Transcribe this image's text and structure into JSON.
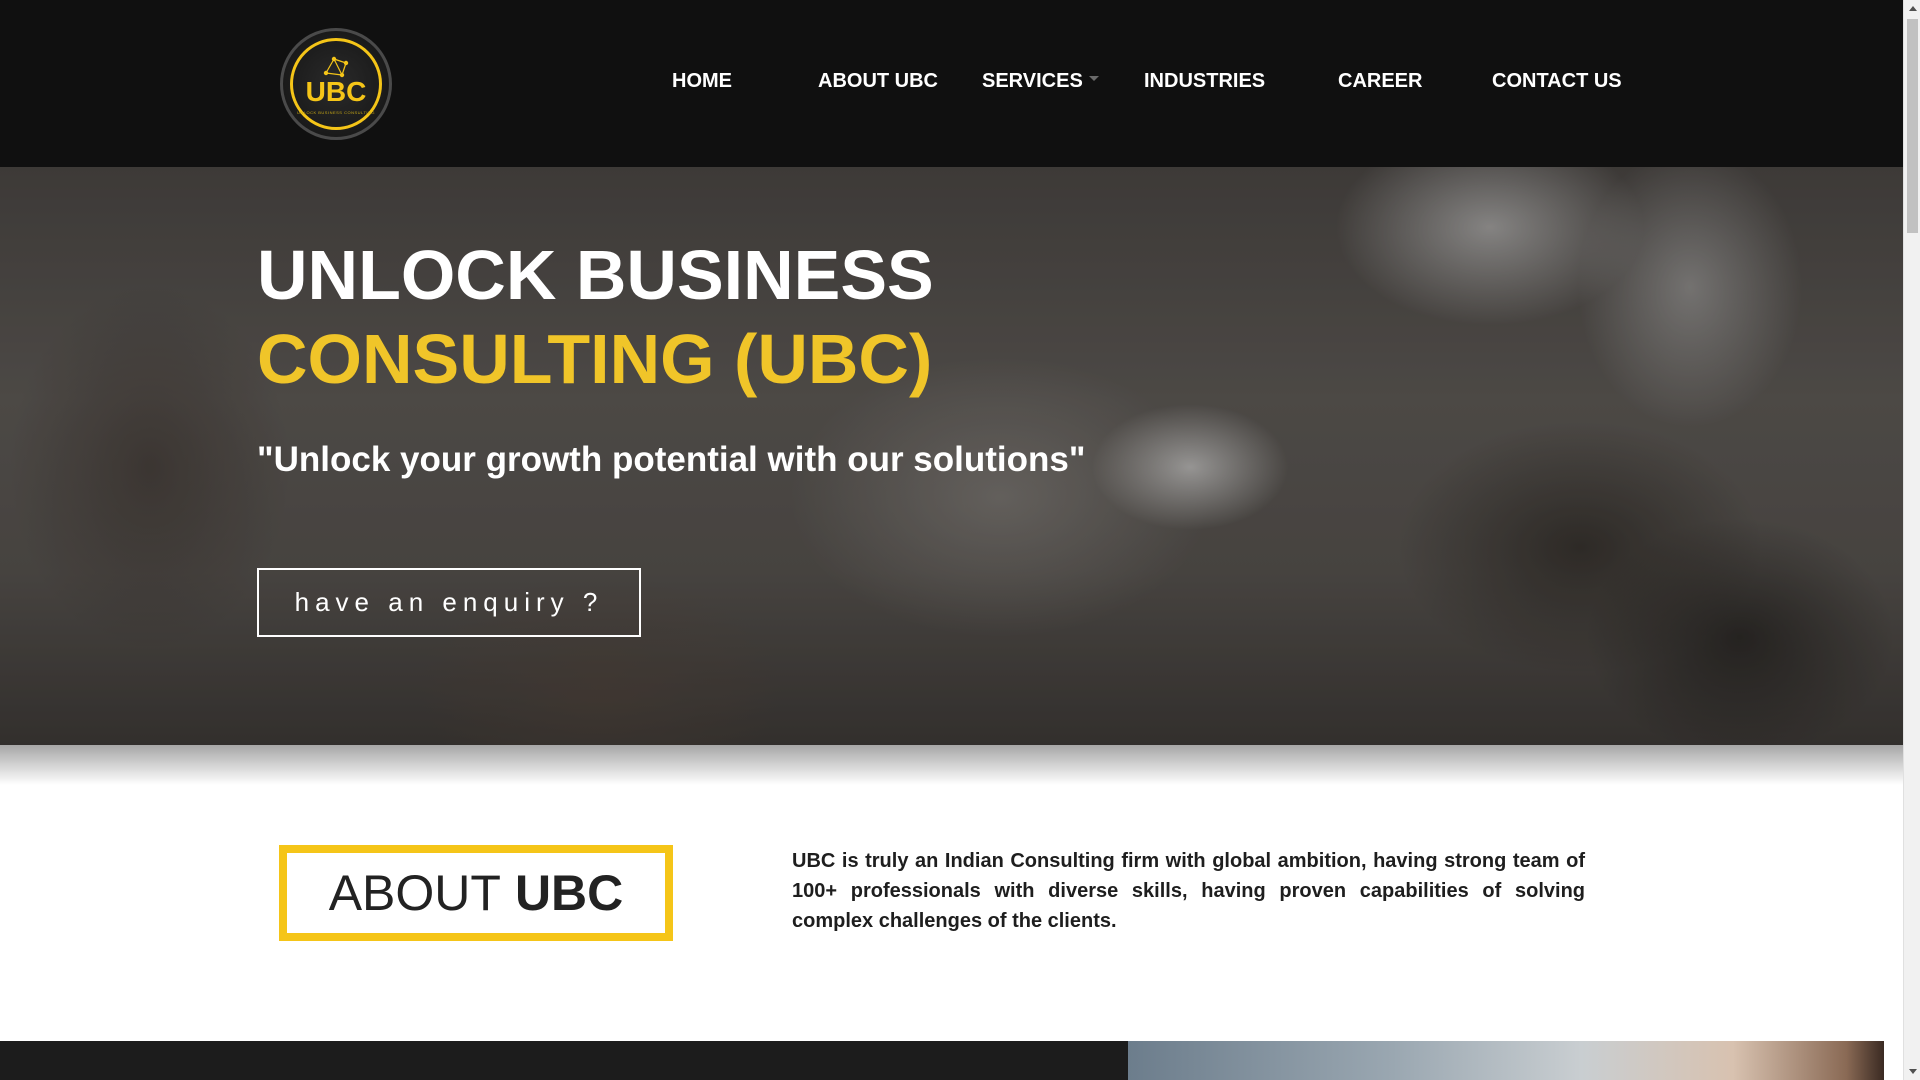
{
  "header": {
    "logo_text": "UBC",
    "logo_tagline": "UNLOCK BUSINESS CONSULTING",
    "nav": [
      {
        "label": "HOME"
      },
      {
        "label": "ABOUT UBC"
      },
      {
        "label": "SERVICES",
        "has_dropdown": true
      },
      {
        "label": "INDUSTRIES"
      },
      {
        "label": "CAREER"
      },
      {
        "label": "CONTACT US"
      }
    ]
  },
  "hero": {
    "title_line1": "UNLOCK BUSINESS",
    "title_line2": "CONSULTING (UBC)",
    "quote": "\"Unlock your growth potential with our solutions\"",
    "cta_label": "have an enquiry ?"
  },
  "about": {
    "heading_light": "ABOUT",
    "heading_bold": "UBC",
    "text": "UBC is truly an Indian Consulting firm with global ambition, having strong team of 100+ professionals with diverse skills, having proven capabilities of solving complex challenges of the clients."
  },
  "colors": {
    "accent": "#f5c518",
    "header_bg": "#101010",
    "text_dark": "#1e1e1e"
  },
  "icons": {
    "logo_mark": "network-nodes-icon",
    "dropdown": "caret-down-icon"
  }
}
